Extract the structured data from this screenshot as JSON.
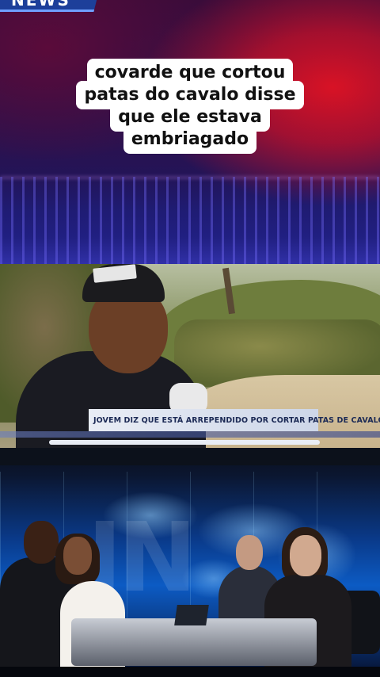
{
  "banner": {
    "logo_text": "NEWS",
    "caption_lines": [
      "covarde que cortou",
      "patas do cavalo disse",
      "que ele estava",
      "embriagado"
    ]
  },
  "interview_clip": {
    "lower_third": "JOVEM DIZ QUE ESTÁ ARREPENDIDO POR CORTAR PATAS DE CAVALO"
  },
  "colors": {
    "banner_red": "#d81225",
    "banner_purple": "#2a1250",
    "lower_third_text": "#1c2a55",
    "studio_blue": "#0c5bc4"
  }
}
